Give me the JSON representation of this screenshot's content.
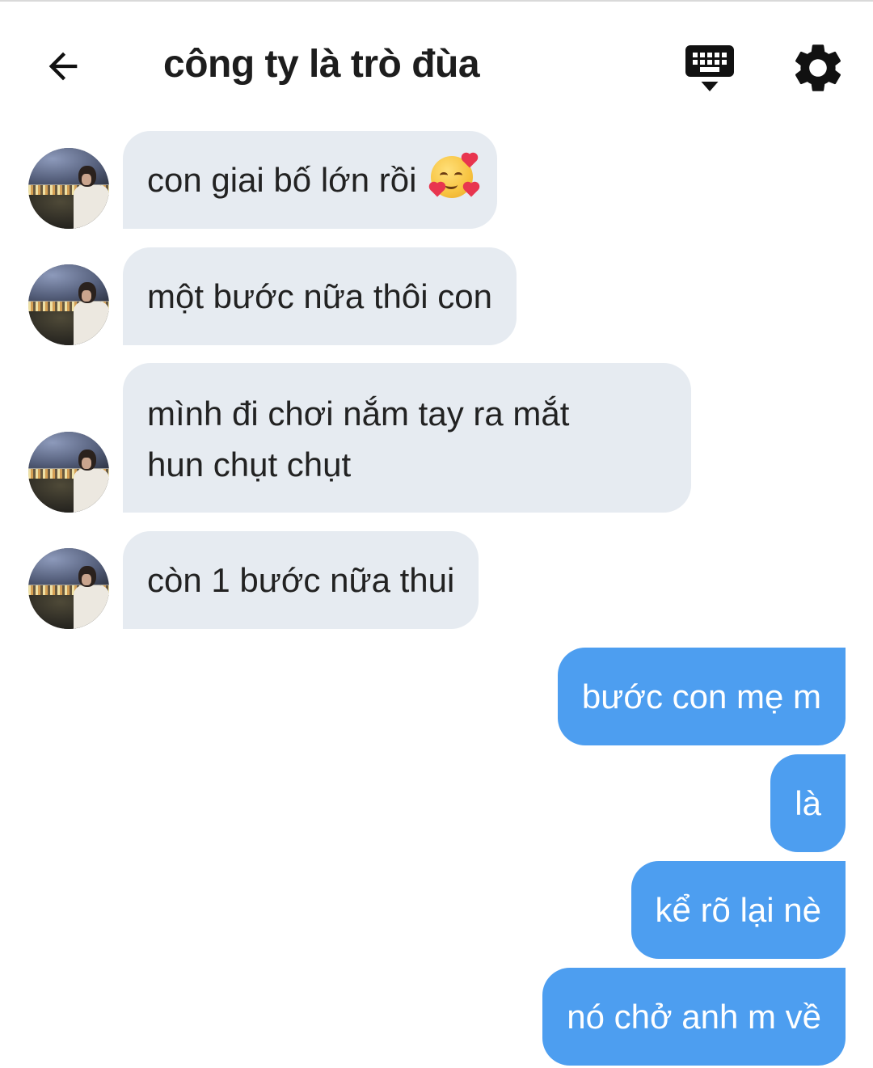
{
  "header": {
    "title": "công ty là trò đùa",
    "back_icon": "arrow-left-icon",
    "keyboard_icon": "keyboard-hide-icon",
    "settings_icon": "gear-icon"
  },
  "messages": [
    {
      "direction": "incoming",
      "text": "con giai bố lớn rồi",
      "emoji": "smiling-face-with-hearts"
    },
    {
      "direction": "incoming",
      "text": "một bước nữa thôi con"
    },
    {
      "direction": "incoming",
      "text": "mình đi chơi nắm tay ra mắt",
      "text_line2": "hun chụt chụt"
    },
    {
      "direction": "incoming",
      "text": "còn 1 bước nữa thui"
    },
    {
      "direction": "outgoing",
      "text": "bước con mẹ m"
    },
    {
      "direction": "outgoing",
      "text": "là"
    },
    {
      "direction": "outgoing",
      "text": "kể rõ lại nè"
    },
    {
      "direction": "outgoing",
      "text": "nó chở anh m về"
    }
  ],
  "colors": {
    "incoming_bubble": "#e6ebf1",
    "outgoing_bubble": "#4d9ef0",
    "background": "#ffffff"
  }
}
